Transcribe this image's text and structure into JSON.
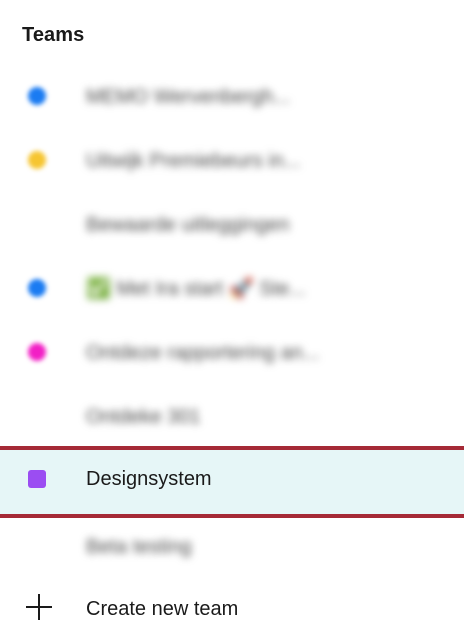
{
  "panel": {
    "title": "Teams"
  },
  "teams": [
    {
      "label": "MEMO Wervenbergh...",
      "color": "#1a7bf2"
    },
    {
      "label": "Uitwijk Premiebeurs in...",
      "color": "#f6c531"
    },
    {
      "label": "Bewaarde uitleggingen",
      "color": ""
    },
    {
      "label": "✅ Met Ira start 🚀 Ste...",
      "color": "#1a7bf2"
    },
    {
      "label": "Ontdeze rapportering an...",
      "color": "#f21fc5"
    },
    {
      "label": "Ontdeke 301",
      "color": ""
    },
    {
      "label": "Designsystem",
      "color": "#9b4df2"
    },
    {
      "label": "Beta testing",
      "color": ""
    }
  ],
  "create": {
    "label": "Create new team",
    "icon": "plus-icon"
  }
}
